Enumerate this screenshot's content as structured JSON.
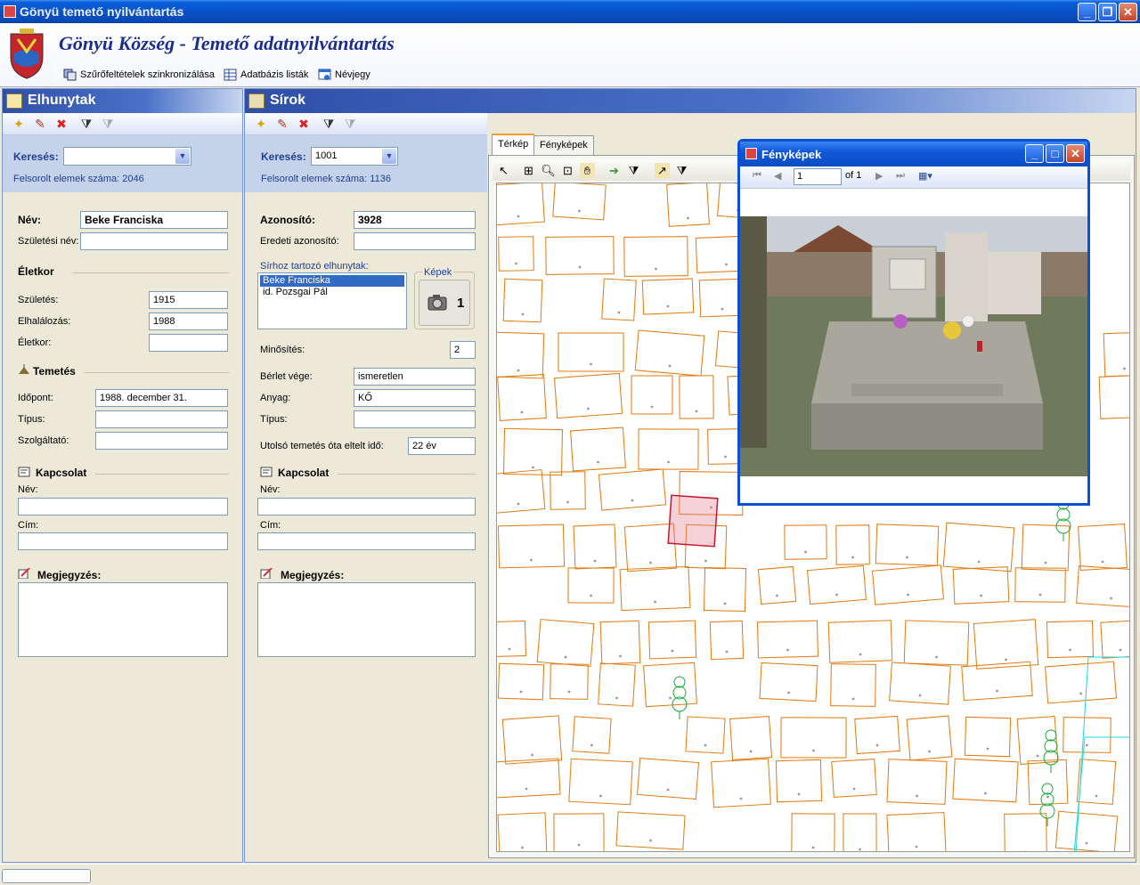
{
  "window": {
    "title": "Gönyü temető nyilvántartás"
  },
  "header": {
    "title": "Gönyü Község - Temető adatnyilvántartás"
  },
  "toolbar": {
    "sync": "Szűrőfeltételek szinkronizálása",
    "db": "Adatbázis listák",
    "about": "Névjegy"
  },
  "left": {
    "title": "Elhunytak",
    "search_label": "Keresés:",
    "search_value": "",
    "count_label": "Felsorolt elemek száma:",
    "count": "2046",
    "name_label": "Név:",
    "name": "Beke Franciska",
    "birthname_label": "Születési név:",
    "birthname": "",
    "age_section": "Életkor",
    "birth_label": "Születés:",
    "birth": "1915",
    "death_label": "Elhalálozás:",
    "death": "1988",
    "age_label": "Életkor:",
    "age": "",
    "burial_section": "Temetés",
    "time_label": "Időpont:",
    "time": "1988. december 31.",
    "type_label": "Típus:",
    "type": "",
    "provider_label": "Szolgáltató:",
    "provider": "",
    "contact_section": "Kapcsolat",
    "cname_label": "Név:",
    "caddr_label": "Cím:",
    "note_label": "Megjegyzés:"
  },
  "mid": {
    "title": "Sírok",
    "search_label": "Keresés:",
    "search_value": "1001",
    "count_label": "Felsorolt elemek száma:",
    "count": "1136",
    "id_label": "Azonosító:",
    "id": "3928",
    "orig_label": "Eredeti azonosító:",
    "orig": "",
    "deceased_label": "Sírhoz tartozó elhunytak:",
    "deceased": [
      "Beke Franciska",
      "id. Pozsgai Pál"
    ],
    "images_label": "Képek",
    "images_count": "1",
    "rating_label": "Minősítés:",
    "rating": "2",
    "lease_label": "Bérlet vége:",
    "lease": "ismeretlen",
    "material_label": "Anyag:",
    "material": "KŐ",
    "type_label": "Típus:",
    "type": "",
    "elapsed_label": "Utolsó temetés óta eltelt idő:",
    "elapsed": "22 év",
    "contact_section": "Kapcsolat",
    "cname_label": "Név:",
    "caddr_label": "Cím:",
    "note_label": "Megjegyzés:"
  },
  "tabs": {
    "map": "Térkép",
    "photos": "Fényképek"
  },
  "photo_window": {
    "title": "Fényképek",
    "page": "1",
    "of": "of 1"
  },
  "colors": {
    "plot_outline": "#e07a10",
    "selected_plot": "#c0192e",
    "tree": "#1aa83a",
    "road": "#1fd6e0"
  }
}
